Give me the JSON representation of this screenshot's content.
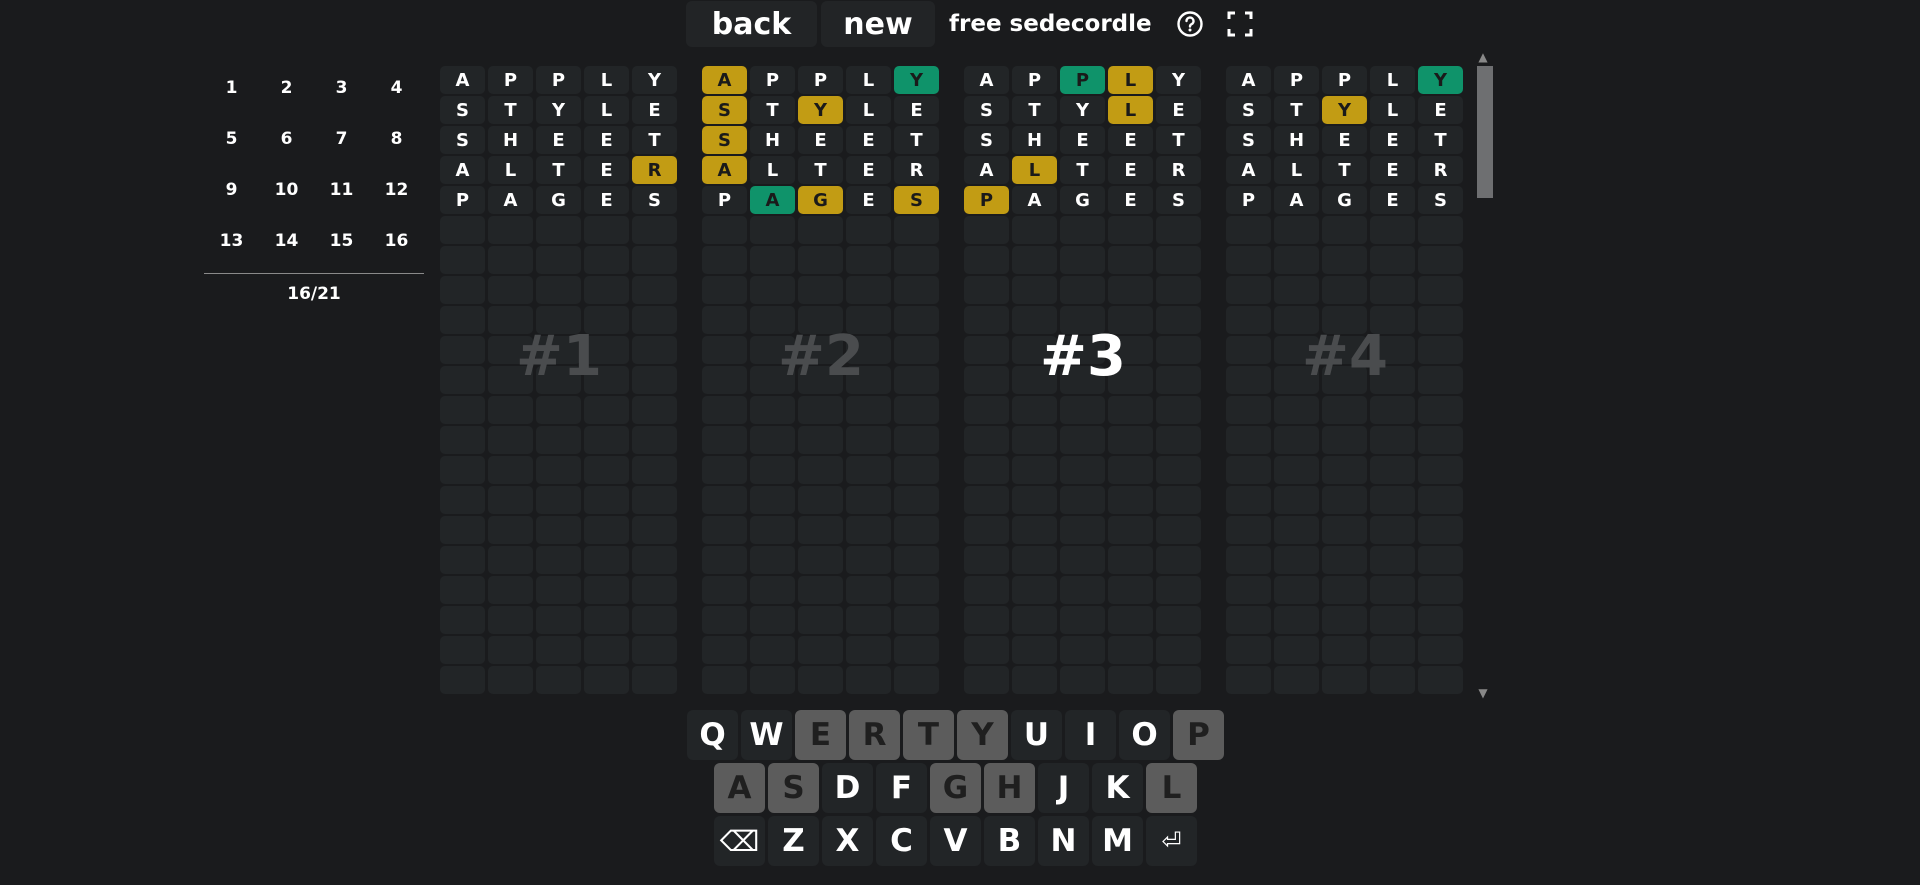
{
  "header": {
    "back_label": "back",
    "new_label": "new",
    "title": "free sedecordle",
    "help_icon": "question-circle-icon",
    "fullscreen_icon": "fullscreen-icon"
  },
  "nav": {
    "boards": [
      "1",
      "2",
      "3",
      "4",
      "5",
      "6",
      "7",
      "8",
      "9",
      "10",
      "11",
      "12",
      "13",
      "14",
      "15",
      "16"
    ],
    "guess_count": "16/21"
  },
  "colors": {
    "background": "#1a1b1d",
    "tile_empty": "#222527",
    "yellow": "#c29c14",
    "green": "#0f936a",
    "key_used": "#5c5c5c"
  },
  "game": {
    "total_rows": 21,
    "guesses": [
      "APPLY",
      "STYLE",
      "SHEET",
      "ALTER",
      "PAGES"
    ],
    "active_board": 3,
    "boards": [
      {
        "label": "#1",
        "states": [
          "-----",
          "-----",
          "-----",
          "----y",
          "-----"
        ]
      },
      {
        "label": "#2",
        "states": [
          "y---g",
          "y-y--",
          "y----",
          "y----",
          "-gy-y"
        ]
      },
      {
        "label": "#3",
        "states": [
          "--gy-",
          "---y-",
          "-----",
          "-y---",
          "y----"
        ]
      },
      {
        "label": "#4",
        "states": [
          "----g",
          "--y--",
          "-----",
          "-----",
          "-----"
        ]
      }
    ]
  },
  "keyboard": {
    "rows": [
      [
        {
          "k": "Q",
          "used": false
        },
        {
          "k": "W",
          "used": false
        },
        {
          "k": "E",
          "used": true
        },
        {
          "k": "R",
          "used": true
        },
        {
          "k": "T",
          "used": true
        },
        {
          "k": "Y",
          "used": true
        },
        {
          "k": "U",
          "used": false
        },
        {
          "k": "I",
          "used": false
        },
        {
          "k": "O",
          "used": false
        },
        {
          "k": "P",
          "used": true
        }
      ],
      [
        {
          "k": "A",
          "used": true
        },
        {
          "k": "S",
          "used": true
        },
        {
          "k": "D",
          "used": false
        },
        {
          "k": "F",
          "used": false
        },
        {
          "k": "G",
          "used": true
        },
        {
          "k": "H",
          "used": true
        },
        {
          "k": "J",
          "used": false
        },
        {
          "k": "K",
          "used": false
        },
        {
          "k": "L",
          "used": true
        }
      ],
      [
        {
          "k": "⌫",
          "used": false,
          "name": "backspace"
        },
        {
          "k": "Z",
          "used": false
        },
        {
          "k": "X",
          "used": false
        },
        {
          "k": "C",
          "used": false
        },
        {
          "k": "V",
          "used": false
        },
        {
          "k": "B",
          "used": false
        },
        {
          "k": "N",
          "used": false
        },
        {
          "k": "M",
          "used": false
        },
        {
          "k": "⏎",
          "used": false,
          "name": "enter"
        }
      ]
    ]
  }
}
